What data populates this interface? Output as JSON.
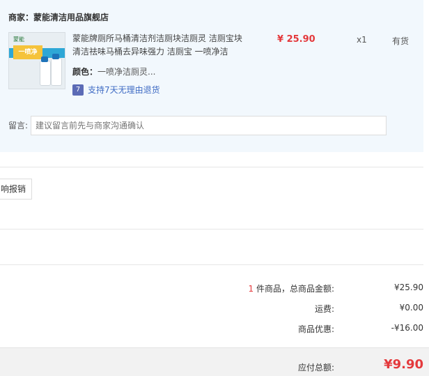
{
  "seller": {
    "label": "商家：",
    "name": "蒙能清洁用品旗舰店"
  },
  "product": {
    "title": "蒙能牌厕所马桶清洁剂洁厕块洁厕灵 洁厕宝块清洁祛味马桶去异味强力 洁厕宝 一喷净洁",
    "spec_label": "颜色：",
    "spec_value": "一喷净洁厕灵...",
    "refund_icon": "7",
    "refund_text": "支持7天无理由退货",
    "price": "¥ 25.90",
    "quantity": "x1",
    "stock": "有货",
    "thumb_logo": "蒙能",
    "thumb_badge": "一喷净"
  },
  "note": {
    "label": "留言:",
    "placeholder": "建议留言前先与商家沟通确认"
  },
  "report_button": "响报销",
  "summary": {
    "count": "1",
    "items_label": " 件商品，总商品金额:",
    "items_value": "¥25.90",
    "shipping_label": "运费:",
    "shipping_value": "¥0.00",
    "discount_label": "商品优惠:",
    "discount_value": "-¥16.00",
    "total_label": "应付总额:",
    "total_value": "¥9.90"
  },
  "colors": {
    "accent": "#e4393c",
    "panel": "#f2f8fd",
    "link": "#3f6bc4"
  }
}
